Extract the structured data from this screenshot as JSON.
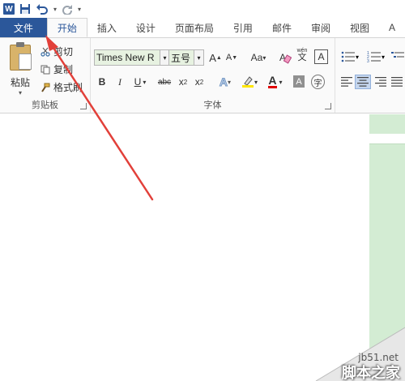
{
  "quick_access": {
    "app_icon": "word-logo-icon",
    "save_icon": "save-icon",
    "undo_icon": "undo-icon",
    "redo_icon": "redo-icon",
    "customize_icon": "qat-customize-icon"
  },
  "tabs": [
    {
      "label": "文件"
    },
    {
      "label": "开始"
    },
    {
      "label": "插入"
    },
    {
      "label": "设计"
    },
    {
      "label": "页面布局"
    },
    {
      "label": "引用"
    },
    {
      "label": "邮件"
    },
    {
      "label": "审阅"
    },
    {
      "label": "视图"
    },
    {
      "label": "A"
    }
  ],
  "clipboard": {
    "paste_label": "粘贴",
    "cut_label": "剪切",
    "copy_label": "复制",
    "format_painter_label": "格式刷",
    "group_label": "剪贴板"
  },
  "font": {
    "font_name": "Times New R",
    "font_size": "五号",
    "grow_label": "A",
    "shrink_label": "A",
    "case_label": "Aa",
    "clear_icon": "clear-format-icon",
    "phonetic_top": "wén",
    "phonetic_bottom": "文",
    "border_char": "A",
    "bold": "B",
    "italic": "I",
    "underline": "U",
    "strike": "abc",
    "subscript": "x",
    "sub_mark": "2",
    "superscript": "x",
    "sup_mark": "2",
    "effects": "A",
    "highlight_icon": "highlight-icon",
    "font_color": "A",
    "shading_char": "A",
    "enclose_char": "字",
    "group_label": "字体"
  },
  "colors": {
    "brand": "#2b579a",
    "highlight": "#ffe600",
    "font_color": "#e00000",
    "arrow": "#e2403a",
    "page_green": "#d3ecd3"
  },
  "watermark": {
    "url": "jb51.net",
    "cn": "脚本之家"
  }
}
